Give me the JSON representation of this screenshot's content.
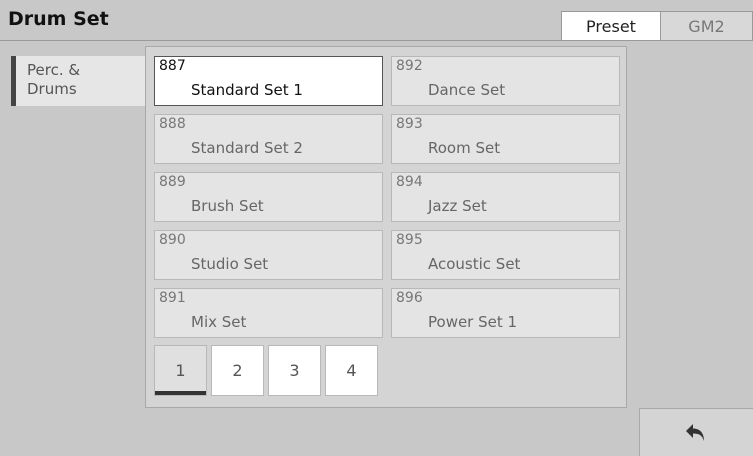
{
  "header": {
    "title": "Drum Set"
  },
  "tabs": {
    "preset": "Preset",
    "gm2": "GM2"
  },
  "category": {
    "label": "Perc. &\nDrums"
  },
  "sets": [
    {
      "num": "887",
      "name": "Standard Set 1",
      "selected": true
    },
    {
      "num": "888",
      "name": "Standard Set 2"
    },
    {
      "num": "889",
      "name": "Brush Set"
    },
    {
      "num": "890",
      "name": "Studio Set"
    },
    {
      "num": "891",
      "name": "Mix Set"
    },
    {
      "num": "892",
      "name": "Dance Set"
    },
    {
      "num": "893",
      "name": "Room Set"
    },
    {
      "num": "894",
      "name": "Jazz Set"
    },
    {
      "num": "895",
      "name": "Acoustic Set"
    },
    {
      "num": "896",
      "name": "Power Set 1"
    }
  ],
  "pages": [
    "1",
    "2",
    "3",
    "4"
  ],
  "current_page": "1",
  "icons": {
    "back": "return-arrow-icon"
  },
  "colors": {
    "background": "#c8c8c8",
    "selected_card": "#ffffff",
    "page_indicator": "#333333"
  }
}
